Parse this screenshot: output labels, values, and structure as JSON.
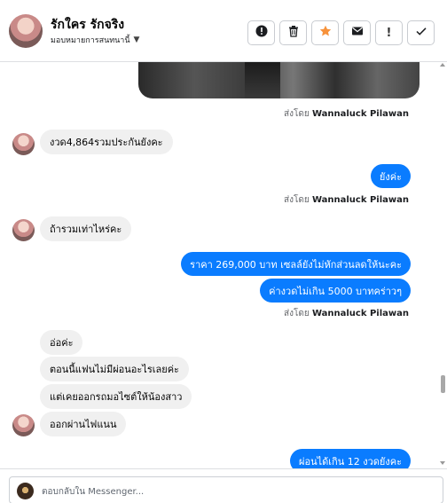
{
  "header": {
    "name": "รักใคร รักจริง",
    "assign_label": "มอบหมายการสนทนานี้",
    "actions": [
      {
        "icon": "exclamation-circle-icon",
        "glyph": "!"
      },
      {
        "icon": "trash-icon",
        "glyph": ""
      },
      {
        "icon": "star-icon",
        "glyph": "★"
      },
      {
        "icon": "envelope-icon",
        "glyph": ""
      },
      {
        "icon": "exclamation-icon",
        "glyph": "!"
      },
      {
        "icon": "check-icon",
        "glyph": "✓"
      }
    ],
    "star_color": "#f7923b"
  },
  "colors": {
    "outgoing_bubble": "#0a7cff",
    "incoming_bubble": "#f0f0f0"
  },
  "messages": {
    "sent_by_prefix": "ส่งโดย",
    "sender_name": "Wannaluck Pilawan",
    "m1": "งวด4,864รวมประกันยังคะ",
    "m2": "ยังค่ะ",
    "m3": "ถ้ารวมเท่าไหร่คะ",
    "m4": "ราคา 269,000 บาท  เซลล์ยังไม่หักส่วนลดให้นะคะ",
    "m5": "ค่างวดไม่เกิน 5000 บาทคร่าวๆ",
    "m6": "อ่อค่ะ",
    "m7": "ตอนนี้แฟนไม่มีผ่อนอะไรเลยค่ะ",
    "m8": "แต่เคยออกรถมอไซต์ให้น้องสาว",
    "m9": "ออกผ่านไฟแนน",
    "m10": "ผ่อนได้เกิน 12 งวดยังคะ"
  },
  "composer": {
    "placeholder": "ตอบกลับใน Messenger..."
  }
}
